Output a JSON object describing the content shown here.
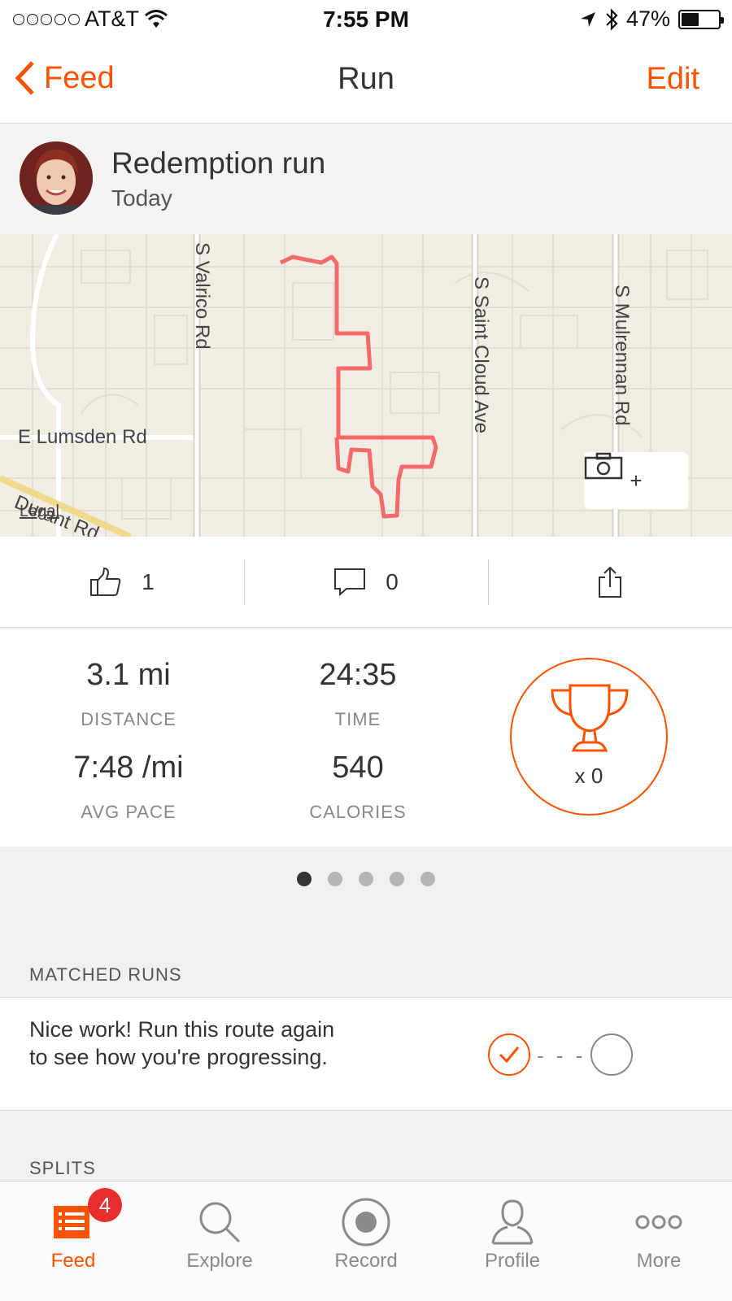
{
  "status_bar": {
    "carrier": "AT&T",
    "time": "7:55 PM",
    "battery": "47%",
    "battery_level": 0.47
  },
  "nav": {
    "back_label": "Feed",
    "title": "Run",
    "edit_label": "Edit"
  },
  "activity": {
    "title": "Redemption run",
    "date": "Today"
  },
  "map": {
    "labels": {
      "valrico": "S Valrico Rd",
      "saint_cloud": "S Saint Cloud Ave",
      "mulrennan": "S Mulrennan Rd",
      "lumsden": "E Lumsden Rd",
      "durant": "Durant Rd",
      "legal": "Legal"
    },
    "route_color": "#f26a6a",
    "photo_add_label": "+"
  },
  "actions": {
    "kudos_count": "1",
    "comment_count": "0"
  },
  "stats": {
    "distance_value": "3.1 mi",
    "distance_label": "DISTANCE",
    "time_value": "24:35",
    "time_label": "TIME",
    "pace_value": "7:48 /mi",
    "pace_label": "AVG PACE",
    "calories_value": "540",
    "calories_label": "CALORIES",
    "achievements": "x 0"
  },
  "pager": {
    "pages": 5,
    "active": 0
  },
  "matched_runs": {
    "section_title": "MATCHED RUNS",
    "message": "Nice work! Run this route again to see how you're progressing.",
    "dash": "- - -"
  },
  "splits": {
    "section_title": "SPLITS"
  },
  "tabbar": {
    "tabs": [
      {
        "label": "Feed"
      },
      {
        "label": "Explore"
      },
      {
        "label": "Record"
      },
      {
        "label": "Profile"
      },
      {
        "label": "More"
      }
    ],
    "feed_badge": "4"
  },
  "colors": {
    "accent": "#fc5200",
    "badge": "#e62e2e"
  }
}
